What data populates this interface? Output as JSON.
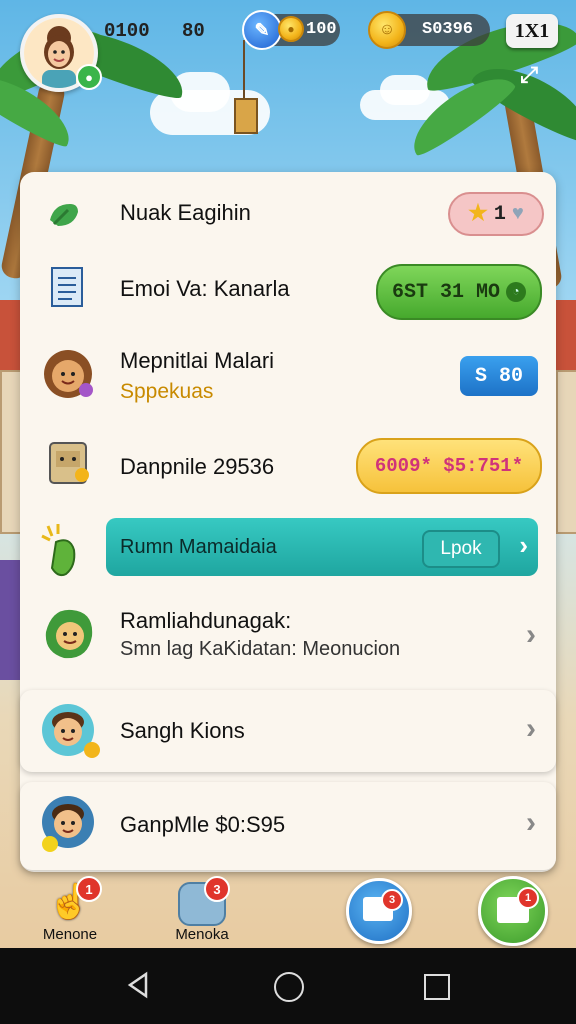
{
  "hud": {
    "counter_left": "0100",
    "counter_mid": "80",
    "gem_value": "100",
    "coin_value": "S0396",
    "multiplier": "1X1"
  },
  "rows": [
    {
      "title": "Nuak Eagihin",
      "badge_count": "1"
    },
    {
      "title": "Emoi Va: Kanarla",
      "button": "6ST 31 MO"
    },
    {
      "title": "Mepnitlai Malari",
      "subtitle": "Sppekuas",
      "button": "S 80"
    },
    {
      "title": "Danpnile 29536",
      "button": "6009* $5:751*"
    },
    {
      "title": "Rumn Mamaidaia",
      "button": "Lpok"
    },
    {
      "title": "Ramliahdunagak:",
      "subtitle": "Smn lag KaKidatan: Meonucion"
    },
    {
      "title": "Sangh Kions"
    },
    {
      "title": "GanpMle $0:S95"
    }
  ],
  "bottom_tabs": [
    {
      "label": "Menone",
      "badge": "1"
    },
    {
      "label": "Menoka",
      "badge": "3"
    },
    {
      "label": "",
      "badge": "3"
    },
    {
      "label": "",
      "badge": "1"
    }
  ],
  "colors": {
    "green_button": "#5cc13a",
    "blue_button": "#2a86d6",
    "yellow_button": "#ffd24a",
    "teal_banner": "#2bb9b3"
  }
}
